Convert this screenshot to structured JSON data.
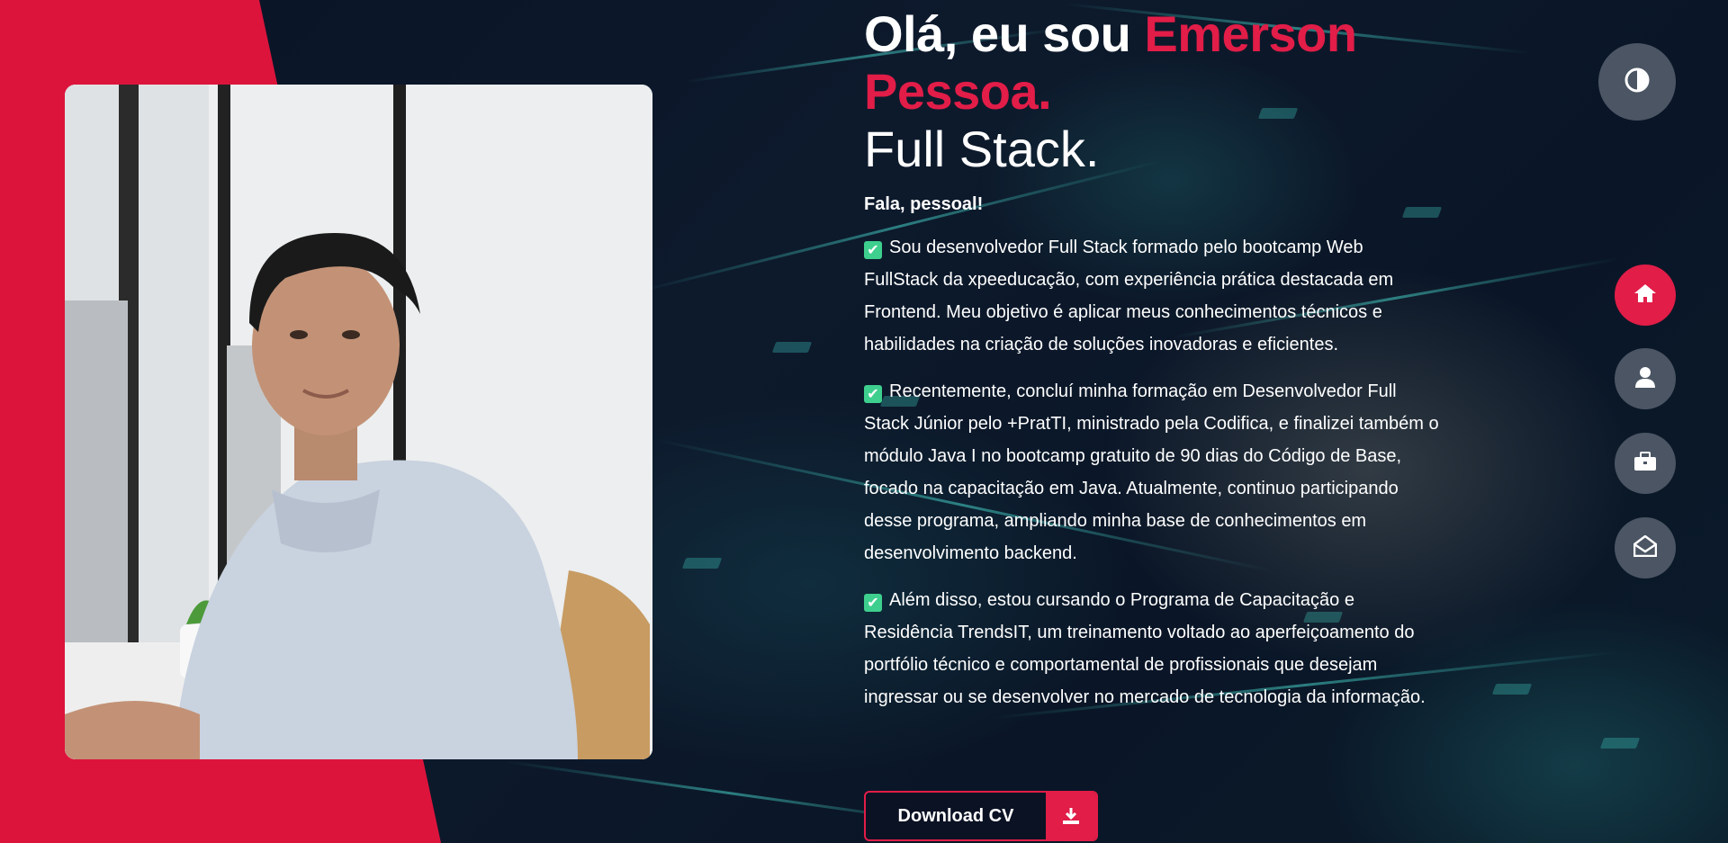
{
  "hero": {
    "title_prefix": "Olá, eu sou ",
    "title_name": "Emerson Pessoa.",
    "subtitle": "Full Stack.",
    "greeting": "Fala, pessoal!",
    "paragraphs": [
      "Sou desenvolvedor Full Stack formado pelo bootcamp Web FullStack da xpeeducação, com experiência prática destacada em Frontend. Meu objetivo é aplicar meus conhecimentos técnicos e habilidades na criação de soluções inovadoras e eficientes.",
      "Recentemente, concluí minha formação em Desenvolvedor Full Stack Júnior pelo +PratTI, ministrado pela Codifica, e finalizei também o módulo Java I no bootcamp gratuito de 90 dias do Código de Base, focado na capacitação em Java. Atualmente, continuo participando desse programa, ampliando minha base de conhecimentos em desenvolvimento backend.",
      "Além disso, estou cursando o Programa de Capacitação e Residência TrendsIT, um treinamento voltado ao aperfeiçoamento do portfólio técnico e comportamental de profissionais que desejam ingressar ou se desenvolver no mercado de tecnologia da informação."
    ],
    "check_icon": "check-box-icon",
    "download_label": "Download CV",
    "download_icon": "download-icon"
  },
  "nav": {
    "theme_icon": "half-circle-contrast-icon",
    "items": [
      {
        "icon": "home-icon",
        "active": true
      },
      {
        "icon": "user-icon",
        "active": false
      },
      {
        "icon": "briefcase-icon",
        "active": false
      },
      {
        "icon": "envelope-open-icon",
        "active": false
      }
    ]
  },
  "colors": {
    "accent": "#e11d48",
    "slab": "#dc143c",
    "nav_bg": "#4b5563",
    "background": "#0b1224",
    "check": "#3ecf8e"
  }
}
